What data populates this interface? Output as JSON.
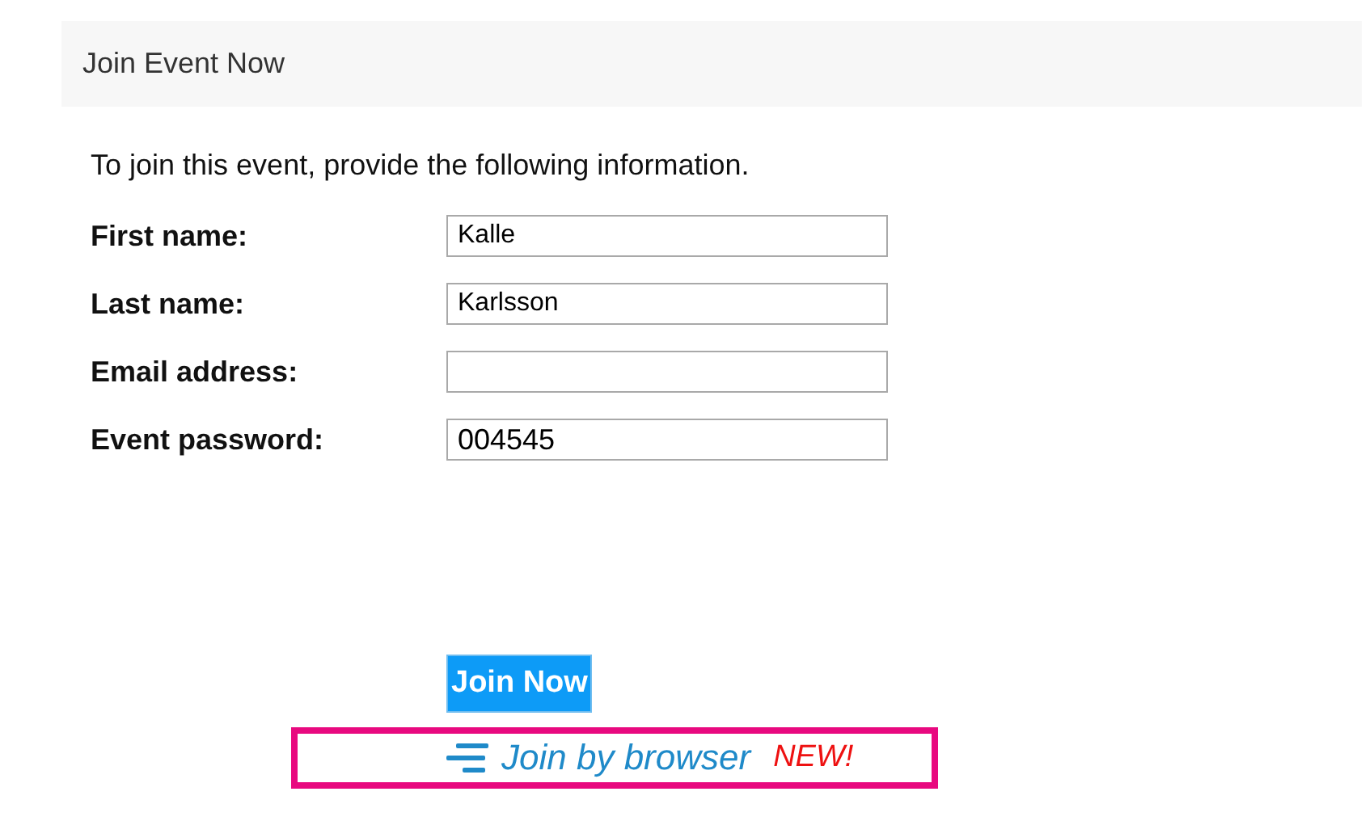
{
  "header": {
    "title": "Join Event Now"
  },
  "intro": "To join this event, provide the following information.",
  "fields": [
    {
      "label": "First name:",
      "value": "Kalle"
    },
    {
      "label": "Last name:",
      "value": "Karlsson"
    },
    {
      "label": "Email address:"
    },
    {
      "label": "Event password:",
      "value": "004545"
    }
  ],
  "join_button": "Join Now",
  "browser_link": {
    "label": "Join by browser",
    "badge": "NEW!"
  }
}
